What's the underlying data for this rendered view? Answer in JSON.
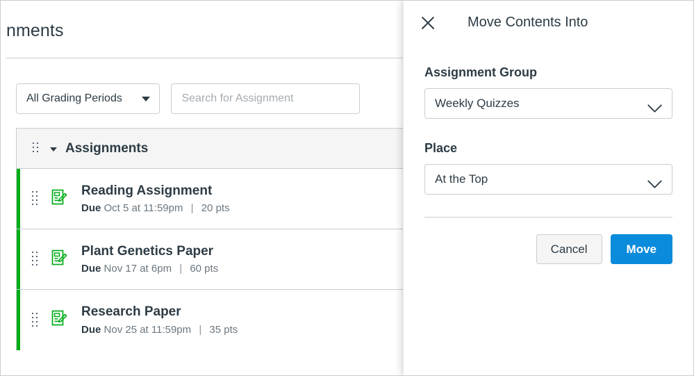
{
  "page": {
    "title": "nments",
    "toolbar": {
      "grading_period_label": "All Grading Periods",
      "search_placeholder": "Search for Assignment",
      "search_value": ""
    },
    "group": {
      "name": "Assignments",
      "percent_badge": "",
      "assignments": [
        {
          "title": "Reading Assignment",
          "due_label": "Due",
          "due_value": "Oct 5 at 11:59pm",
          "separator": "|",
          "points": "20 pts"
        },
        {
          "title": "Plant Genetics Paper",
          "due_label": "Due",
          "due_value": "Nov 17 at 6pm",
          "separator": "|",
          "points": "60 pts"
        },
        {
          "title": "Research Paper",
          "due_label": "Due",
          "due_value": "Nov 25 at 11:59pm",
          "separator": "|",
          "points": "35 pts"
        }
      ]
    }
  },
  "tray": {
    "title": "Move Contents Into",
    "close_label": "Close",
    "assignment_group": {
      "label": "Assignment Group",
      "selected": "Weekly Quizzes"
    },
    "place": {
      "label": "Place",
      "selected": "At the Top"
    },
    "cancel_label": "Cancel",
    "move_label": "Move"
  },
  "colors": {
    "published_green": "#00ac18",
    "primary_blue": "#0b8bdb",
    "text": "#2d3b45",
    "muted_text": "#6b7780",
    "border": "#c7cdd1"
  }
}
